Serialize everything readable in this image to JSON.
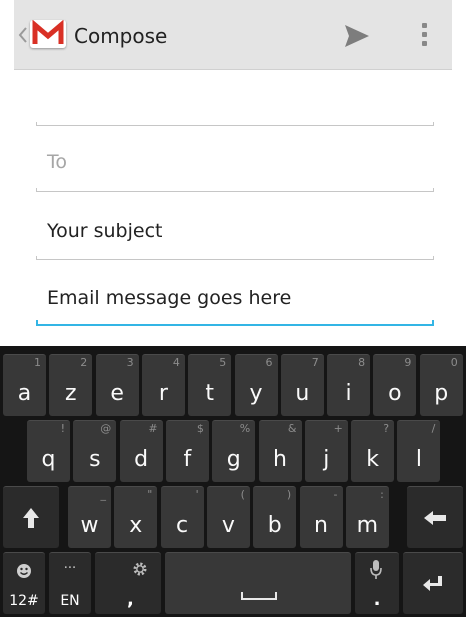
{
  "action_bar": {
    "title": "Compose",
    "app_icon": "gmail-icon",
    "send_icon": "send-icon",
    "overflow_icon": "overflow-menu-icon"
  },
  "compose": {
    "to_placeholder": "To",
    "subject_value": "Your subject",
    "body_value": "Email message goes here"
  },
  "keyboard": {
    "row1": [
      {
        "label": "a",
        "hint": "1"
      },
      {
        "label": "z",
        "hint": "2"
      },
      {
        "label": "e",
        "hint": "3"
      },
      {
        "label": "r",
        "hint": "4"
      },
      {
        "label": "t",
        "hint": "5"
      },
      {
        "label": "y",
        "hint": "6"
      },
      {
        "label": "u",
        "hint": "7"
      },
      {
        "label": "i",
        "hint": "8"
      },
      {
        "label": "o",
        "hint": "9"
      },
      {
        "label": "p",
        "hint": "0"
      }
    ],
    "row2": [
      {
        "label": "q",
        "hint": "!"
      },
      {
        "label": "s",
        "hint": "@"
      },
      {
        "label": "d",
        "hint": "#"
      },
      {
        "label": "f",
        "hint": "$"
      },
      {
        "label": "g",
        "hint": "%"
      },
      {
        "label": "h",
        "hint": "&"
      },
      {
        "label": "j",
        "hint": "+"
      },
      {
        "label": "k",
        "hint": "?"
      },
      {
        "label": "l",
        "hint": "/"
      }
    ],
    "row3": [
      {
        "label": "w",
        "hint": "_"
      },
      {
        "label": "x",
        "hint": "\""
      },
      {
        "label": "c",
        "hint": "'"
      },
      {
        "label": "v",
        "hint": "("
      },
      {
        "label": "b",
        "hint": ")"
      },
      {
        "label": "n",
        "hint": "-"
      },
      {
        "label": "m",
        "hint": ":"
      }
    ],
    "shift_icon": "shift-arrow-icon",
    "backspace_icon": "backspace-icon",
    "symbols_label": "12#",
    "language_label": "EN",
    "language_hint": "...",
    "comma_label": ",",
    "settings_icon": "gear-icon",
    "space_icon": "spacebar-icon",
    "period_label": ".",
    "mic_icon": "microphone-icon",
    "enter_icon": "enter-icon",
    "emoji_icon": "smiley-icon"
  }
}
